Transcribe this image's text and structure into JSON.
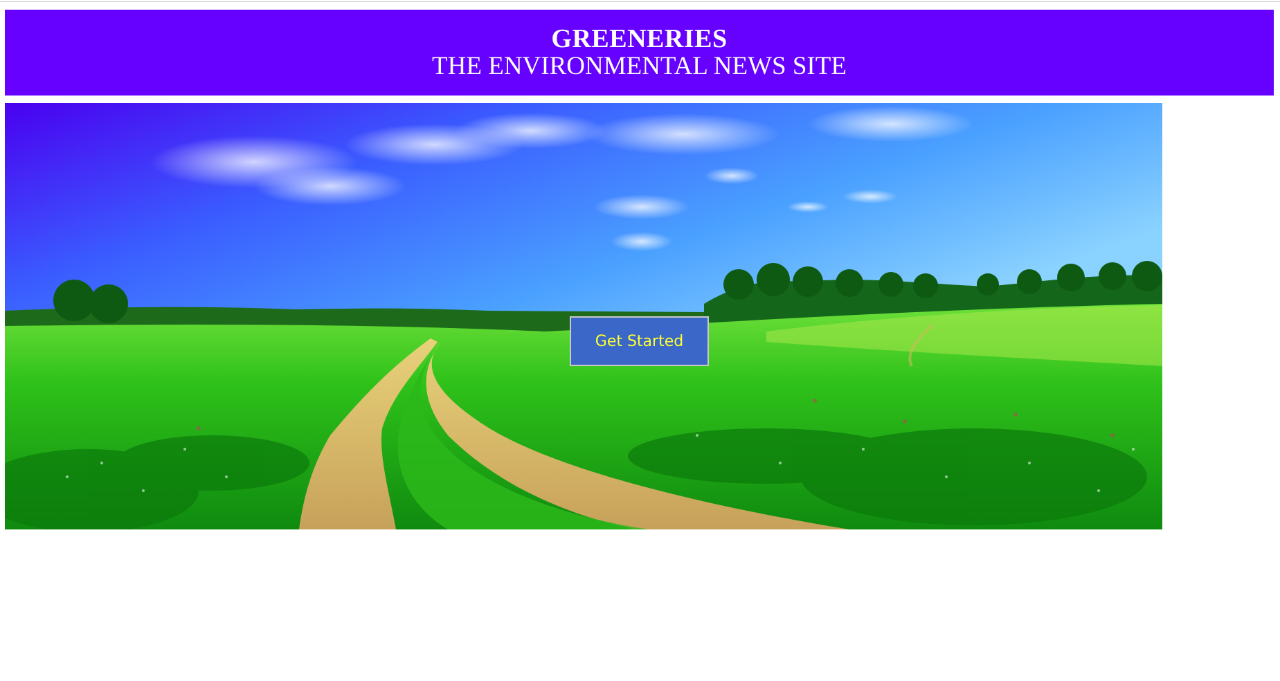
{
  "header": {
    "title": "GREENERIES",
    "subtitle": "THE ENVIRONMENTAL NEWS SITE",
    "background_color": "#6600ff",
    "text_color": "#ffffff"
  },
  "hero": {
    "scene": "landscape-photo",
    "cta_label": "Get Started",
    "cta_background": "#3a67c8",
    "cta_text_color": "#ffff33"
  }
}
